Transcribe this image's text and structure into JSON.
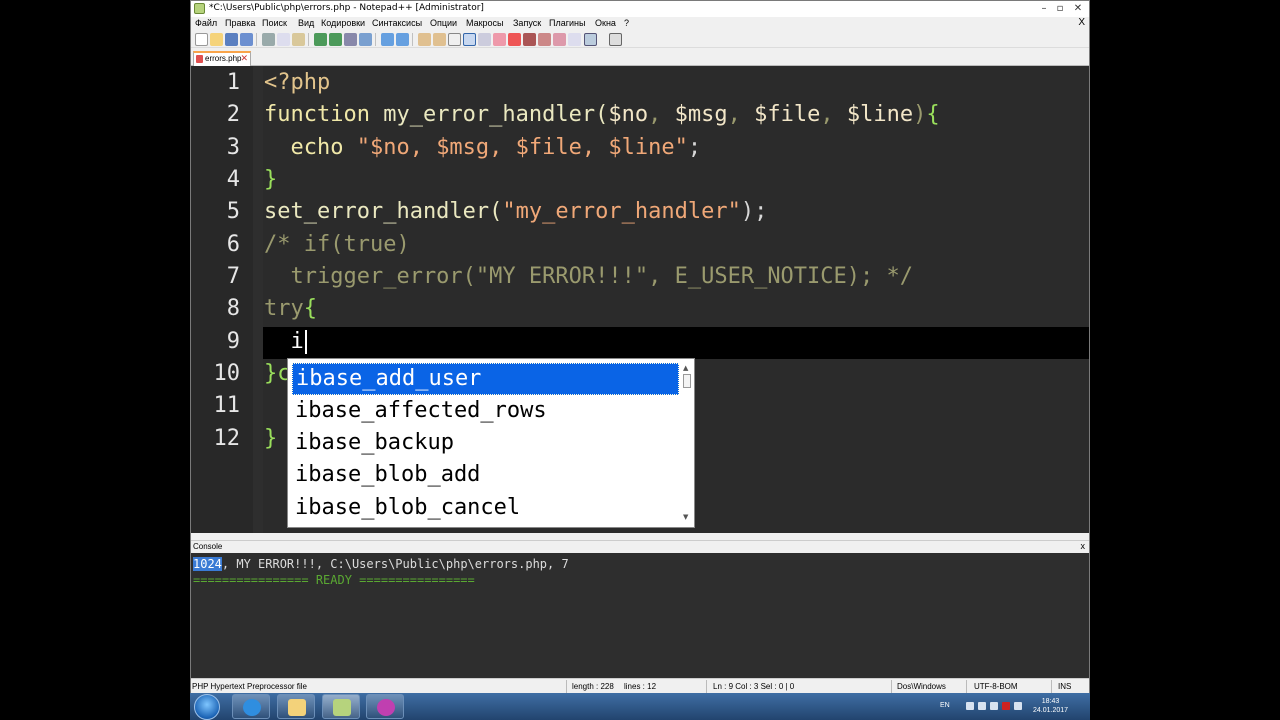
{
  "window": {
    "title": "*C:\\Users\\Public\\php\\errors.php - Notepad++ [Administrator]",
    "minimize_icon": "minimize-icon",
    "maximize_icon": "maximize-icon",
    "close_icon": "close-icon"
  },
  "menu": {
    "items": [
      "Файл",
      "Правка",
      "Поиск",
      "Вид",
      "Кодировки",
      "Синтаксисы",
      "Опции",
      "Макросы",
      "Запуск",
      "Плагины",
      "Окна",
      "?"
    ],
    "close": "X"
  },
  "tab": {
    "label": "errors.php",
    "close": "✕"
  },
  "editor": {
    "line_numbers": [
      "1",
      "2",
      "3",
      "4",
      "5",
      "6",
      "7",
      "8",
      "9",
      "10",
      "11",
      "12"
    ],
    "lines": {
      "l1": "<?php",
      "l2_kw": "function",
      "l2_name": " my_error_handler(",
      "l2_a": "$no",
      "l2_c1": ", ",
      "l2_b": "$msg",
      "l2_c2": ", ",
      "l2_c": "$file",
      "l2_c3": ", ",
      "l2_d": "$line",
      "l2_end": ")",
      "l2_brace": "{",
      "l3_kw": "  echo ",
      "l3_str": "\"$no, $msg, $file, $line\"",
      "l3_end": ";",
      "l4": "}",
      "l5_fn": "set_error_handler(",
      "l5_str": "\"my_error_handler\"",
      "l5_end": ");",
      "l6": "/* if(true)",
      "l7": "  trigger_error(\"MY ERROR!!!\", E_USER_NOTICE); */",
      "l8_kw": "try",
      "l8_brace": "{",
      "l9": "  i",
      "l10": "}c",
      "l12": "}"
    }
  },
  "autocomplete": {
    "items": [
      "ibase_add_user",
      "ibase_affected_rows",
      "ibase_backup",
      "ibase_blob_add",
      "ibase_blob_cancel"
    ],
    "selected_index": 0
  },
  "console": {
    "header": "Console",
    "close": "x",
    "line1_code": "1024",
    "line1_rest": ", MY ERROR!!!, C:\\Users\\Public\\php\\errors.php, 7",
    "line2": "================ READY ================"
  },
  "status": {
    "filetype": "PHP Hypertext Preprocessor file",
    "length": "length : 228",
    "lines": "lines : 12",
    "position": "Ln : 9    Col : 3    Sel : 0 | 0",
    "eol": "Dos\\Windows",
    "encoding": "UTF-8-BOM",
    "mode": "INS"
  },
  "taskbar": {
    "lang": "EN",
    "time": "18:43",
    "date": "24.01.2017"
  },
  "colors": {
    "editor_bg": "#2b2b2b",
    "selection": "#0a64e6",
    "tab_accent": "#f9a44a",
    "console_ready": "#5aa832"
  }
}
